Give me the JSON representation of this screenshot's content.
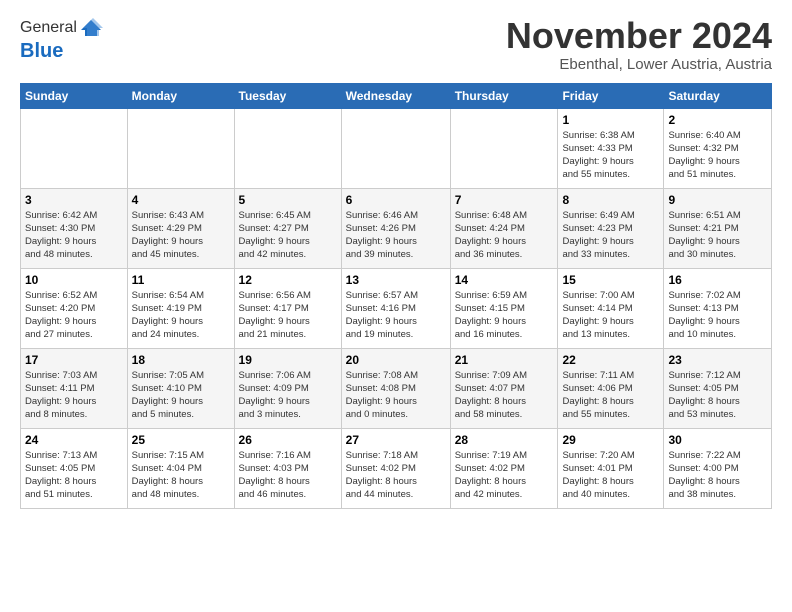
{
  "header": {
    "logo_general": "General",
    "logo_blue": "Blue",
    "month_title": "November 2024",
    "location": "Ebenthal, Lower Austria, Austria"
  },
  "weekdays": [
    "Sunday",
    "Monday",
    "Tuesday",
    "Wednesday",
    "Thursday",
    "Friday",
    "Saturday"
  ],
  "weeks": [
    [
      {
        "day": "",
        "detail": ""
      },
      {
        "day": "",
        "detail": ""
      },
      {
        "day": "",
        "detail": ""
      },
      {
        "day": "",
        "detail": ""
      },
      {
        "day": "",
        "detail": ""
      },
      {
        "day": "1",
        "detail": "Sunrise: 6:38 AM\nSunset: 4:33 PM\nDaylight: 9 hours\nand 55 minutes."
      },
      {
        "day": "2",
        "detail": "Sunrise: 6:40 AM\nSunset: 4:32 PM\nDaylight: 9 hours\nand 51 minutes."
      }
    ],
    [
      {
        "day": "3",
        "detail": "Sunrise: 6:42 AM\nSunset: 4:30 PM\nDaylight: 9 hours\nand 48 minutes."
      },
      {
        "day": "4",
        "detail": "Sunrise: 6:43 AM\nSunset: 4:29 PM\nDaylight: 9 hours\nand 45 minutes."
      },
      {
        "day": "5",
        "detail": "Sunrise: 6:45 AM\nSunset: 4:27 PM\nDaylight: 9 hours\nand 42 minutes."
      },
      {
        "day": "6",
        "detail": "Sunrise: 6:46 AM\nSunset: 4:26 PM\nDaylight: 9 hours\nand 39 minutes."
      },
      {
        "day": "7",
        "detail": "Sunrise: 6:48 AM\nSunset: 4:24 PM\nDaylight: 9 hours\nand 36 minutes."
      },
      {
        "day": "8",
        "detail": "Sunrise: 6:49 AM\nSunset: 4:23 PM\nDaylight: 9 hours\nand 33 minutes."
      },
      {
        "day": "9",
        "detail": "Sunrise: 6:51 AM\nSunset: 4:21 PM\nDaylight: 9 hours\nand 30 minutes."
      }
    ],
    [
      {
        "day": "10",
        "detail": "Sunrise: 6:52 AM\nSunset: 4:20 PM\nDaylight: 9 hours\nand 27 minutes."
      },
      {
        "day": "11",
        "detail": "Sunrise: 6:54 AM\nSunset: 4:19 PM\nDaylight: 9 hours\nand 24 minutes."
      },
      {
        "day": "12",
        "detail": "Sunrise: 6:56 AM\nSunset: 4:17 PM\nDaylight: 9 hours\nand 21 minutes."
      },
      {
        "day": "13",
        "detail": "Sunrise: 6:57 AM\nSunset: 4:16 PM\nDaylight: 9 hours\nand 19 minutes."
      },
      {
        "day": "14",
        "detail": "Sunrise: 6:59 AM\nSunset: 4:15 PM\nDaylight: 9 hours\nand 16 minutes."
      },
      {
        "day": "15",
        "detail": "Sunrise: 7:00 AM\nSunset: 4:14 PM\nDaylight: 9 hours\nand 13 minutes."
      },
      {
        "day": "16",
        "detail": "Sunrise: 7:02 AM\nSunset: 4:13 PM\nDaylight: 9 hours\nand 10 minutes."
      }
    ],
    [
      {
        "day": "17",
        "detail": "Sunrise: 7:03 AM\nSunset: 4:11 PM\nDaylight: 9 hours\nand 8 minutes."
      },
      {
        "day": "18",
        "detail": "Sunrise: 7:05 AM\nSunset: 4:10 PM\nDaylight: 9 hours\nand 5 minutes."
      },
      {
        "day": "19",
        "detail": "Sunrise: 7:06 AM\nSunset: 4:09 PM\nDaylight: 9 hours\nand 3 minutes."
      },
      {
        "day": "20",
        "detail": "Sunrise: 7:08 AM\nSunset: 4:08 PM\nDaylight: 9 hours\nand 0 minutes."
      },
      {
        "day": "21",
        "detail": "Sunrise: 7:09 AM\nSunset: 4:07 PM\nDaylight: 8 hours\nand 58 minutes."
      },
      {
        "day": "22",
        "detail": "Sunrise: 7:11 AM\nSunset: 4:06 PM\nDaylight: 8 hours\nand 55 minutes."
      },
      {
        "day": "23",
        "detail": "Sunrise: 7:12 AM\nSunset: 4:05 PM\nDaylight: 8 hours\nand 53 minutes."
      }
    ],
    [
      {
        "day": "24",
        "detail": "Sunrise: 7:13 AM\nSunset: 4:05 PM\nDaylight: 8 hours\nand 51 minutes."
      },
      {
        "day": "25",
        "detail": "Sunrise: 7:15 AM\nSunset: 4:04 PM\nDaylight: 8 hours\nand 48 minutes."
      },
      {
        "day": "26",
        "detail": "Sunrise: 7:16 AM\nSunset: 4:03 PM\nDaylight: 8 hours\nand 46 minutes."
      },
      {
        "day": "27",
        "detail": "Sunrise: 7:18 AM\nSunset: 4:02 PM\nDaylight: 8 hours\nand 44 minutes."
      },
      {
        "day": "28",
        "detail": "Sunrise: 7:19 AM\nSunset: 4:02 PM\nDaylight: 8 hours\nand 42 minutes."
      },
      {
        "day": "29",
        "detail": "Sunrise: 7:20 AM\nSunset: 4:01 PM\nDaylight: 8 hours\nand 40 minutes."
      },
      {
        "day": "30",
        "detail": "Sunrise: 7:22 AM\nSunset: 4:00 PM\nDaylight: 8 hours\nand 38 minutes."
      }
    ]
  ]
}
